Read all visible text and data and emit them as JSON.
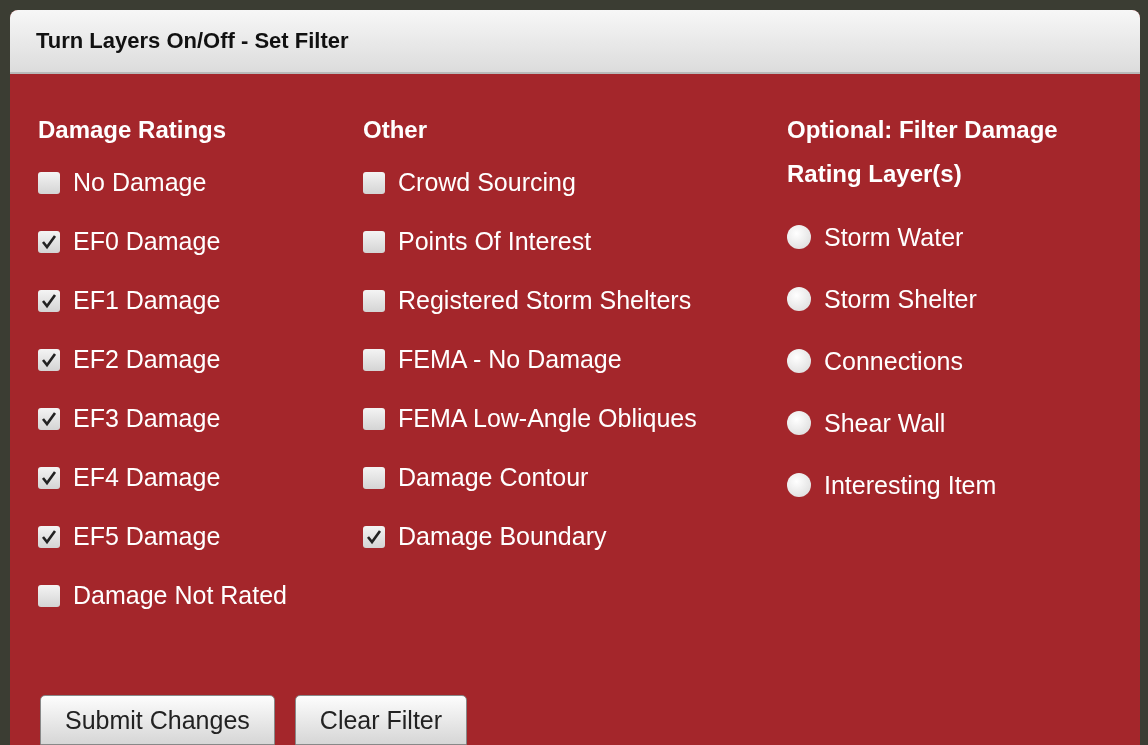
{
  "window": {
    "title": "Turn Layers On/Off - Set Filter"
  },
  "columns": [
    {
      "heading": "Damage Ratings",
      "kind": "checkbox",
      "items": [
        {
          "label": "No Damage",
          "checked": false
        },
        {
          "label": "EF0 Damage",
          "checked": true
        },
        {
          "label": "EF1 Damage",
          "checked": true
        },
        {
          "label": "EF2 Damage",
          "checked": true
        },
        {
          "label": "EF3 Damage",
          "checked": true
        },
        {
          "label": "EF4 Damage",
          "checked": true
        },
        {
          "label": "EF5 Damage",
          "checked": true
        },
        {
          "label": "Damage Not Rated",
          "checked": false
        }
      ]
    },
    {
      "heading": "Other",
      "kind": "checkbox",
      "items": [
        {
          "label": "Crowd Sourcing",
          "checked": false
        },
        {
          "label": "Points Of Interest",
          "checked": false
        },
        {
          "label": "Registered Storm Shelters",
          "checked": false
        },
        {
          "label": "FEMA - No Damage",
          "checked": false
        },
        {
          "label": "FEMA Low-Angle Obliques",
          "checked": false
        },
        {
          "label": "Damage Contour",
          "checked": false
        },
        {
          "label": "Damage Boundary",
          "checked": true
        }
      ]
    },
    {
      "heading": "Optional: Filter Damage Rating Layer(s)",
      "kind": "radio",
      "items": [
        {
          "label": "Storm Water",
          "selected": false
        },
        {
          "label": "Storm Shelter",
          "selected": false
        },
        {
          "label": "Connections",
          "selected": false
        },
        {
          "label": "Shear Wall",
          "selected": false
        },
        {
          "label": "Interesting Item",
          "selected": false
        }
      ]
    }
  ],
  "buttons": [
    "Submit Changes",
    "Clear Filter"
  ]
}
